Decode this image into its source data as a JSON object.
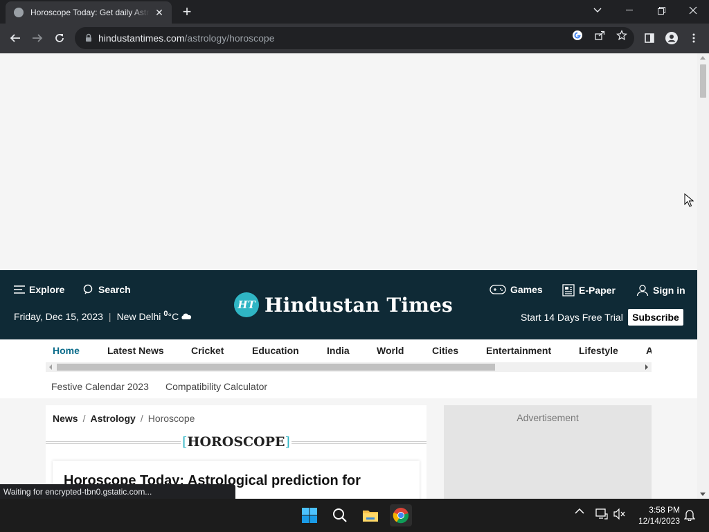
{
  "browser": {
    "tab_title": "Horoscope Today: Get daily Astrology Predictions",
    "url_host": "hindustantimes.com",
    "url_path": "/astrology/horoscope"
  },
  "header": {
    "explore_label": "Explore",
    "search_label": "Search",
    "games_label": "Games",
    "epaper_label": "E-Paper",
    "signin_label": "Sign in",
    "date": "Friday, Dec 15, 2023",
    "city": "New Delhi",
    "temp_unit": "°C",
    "logo_badge": "HT",
    "logo_text": "Hindustan Times",
    "trial_text": "Start 14 Days Free Trial",
    "subscribe_label": "Subscribe"
  },
  "nav": {
    "items": [
      "Home",
      "Latest News",
      "Cricket",
      "Education",
      "India",
      "World",
      "Cities",
      "Entertainment",
      "Lifestyle",
      "Astrology"
    ],
    "active": "Home",
    "sublinks": [
      "Festive Calendar 2023",
      "Compatibility Calculator"
    ]
  },
  "content": {
    "breadcrumb": [
      "News",
      "Astrology",
      "Horoscope"
    ],
    "section_title": "HOROSCOPE",
    "article_title": "Horoscope Today: Astrological prediction for"
  },
  "sidebar_ad": {
    "label": "Advertisement"
  },
  "status_text": "Waiting for encrypted-tbn0.gstatic.com...",
  "taskbar": {
    "time": "3:58 PM",
    "date": "12/14/2023"
  },
  "colors": {
    "header_bg": "#0f2a36",
    "accent": "#2fb5c4",
    "nav_active": "#0a6b8a"
  }
}
